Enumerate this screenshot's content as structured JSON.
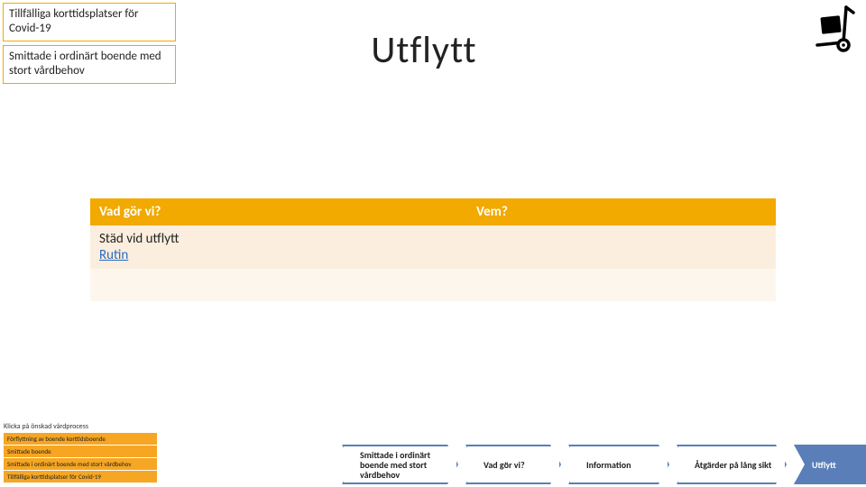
{
  "topboxes": {
    "b1": "Tillfälliga korttidsplatser för Covid-19",
    "b2": "Smittade i ordinärt boende med stort vårdbehov"
  },
  "title": "Utflytt",
  "table": {
    "headers": {
      "col1": "Vad gör vi?",
      "col2": "Vem?"
    },
    "row1": {
      "text": "Städ vid utflytt",
      "link": "Rutin"
    }
  },
  "steps": {
    "s1": "Smittade i ordinärt boende med stort vårdbehov",
    "s2": "Vad gör vi?",
    "s3": "Information",
    "s4": "Åtgärder på lång sikt",
    "s5": "Utflytt"
  },
  "legend": {
    "header": "Klicka på önskad vårdprocess",
    "r1": "Förflyttning av boende korttidsboende",
    "r2": "Smittade boende",
    "r3": "Smittade i ordinärt boende med stort vårdbehov",
    "r4": "Tillfälliga korttidsplatser för Covid-19"
  }
}
